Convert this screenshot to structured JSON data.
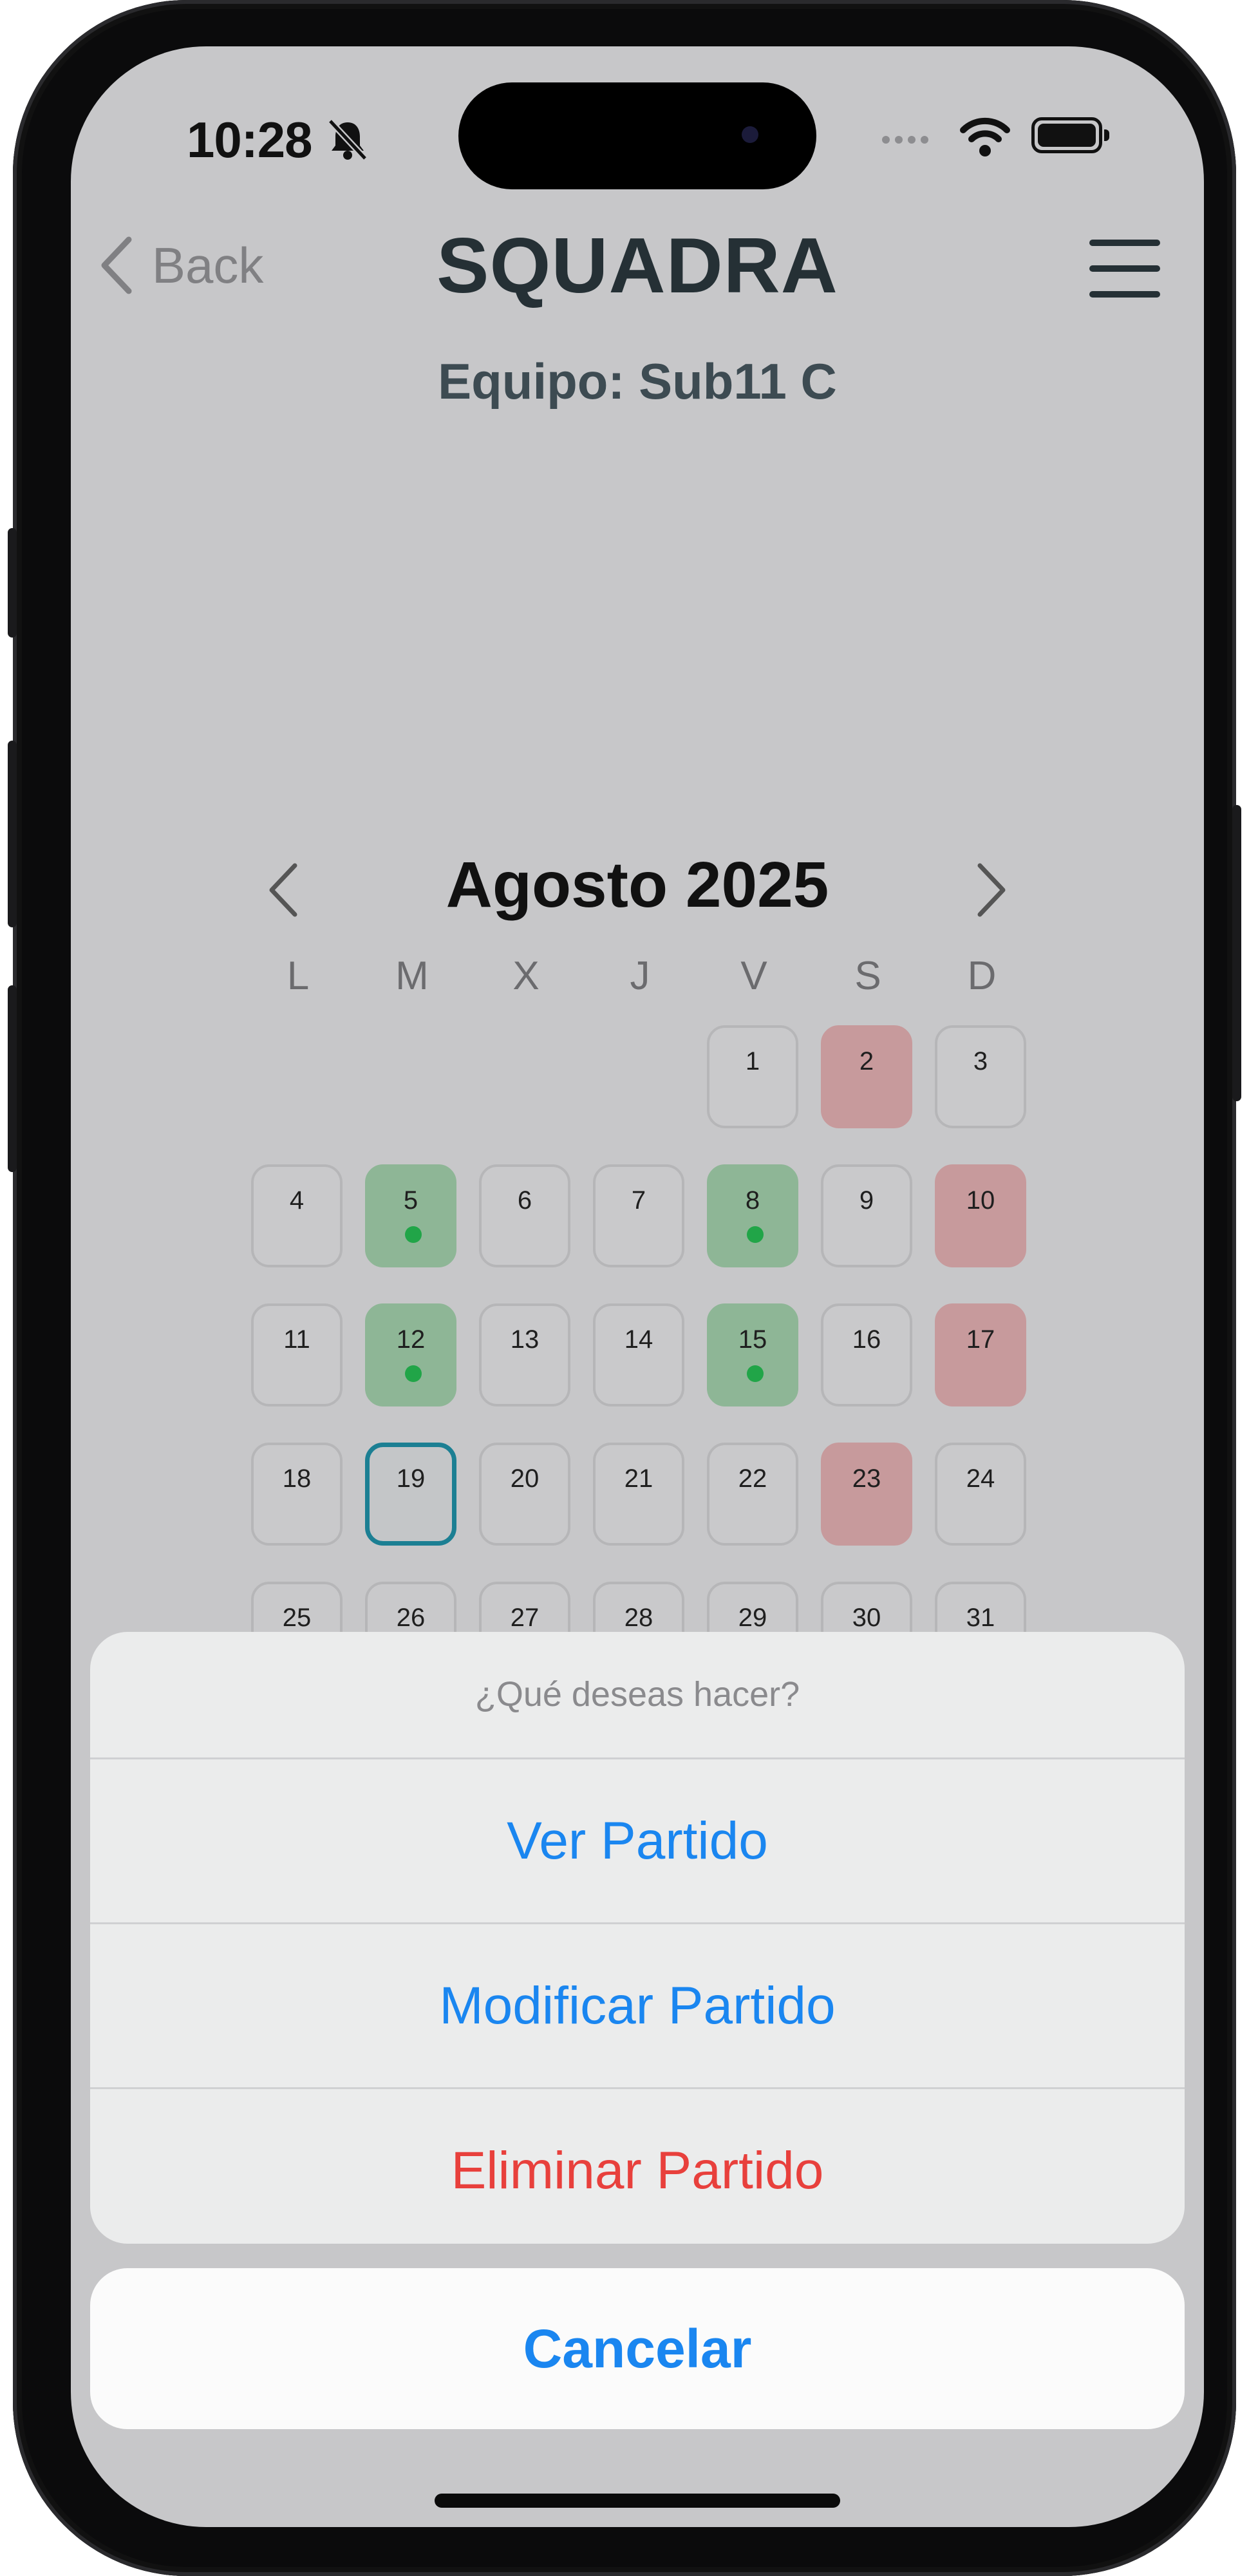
{
  "status_bar": {
    "time": "10:28"
  },
  "nav": {
    "back_label": "Back",
    "app_title": "SQUADRA"
  },
  "team_label": "Equipo: Sub11 C",
  "calendar": {
    "month_label": "Agosto 2025",
    "weekdays": [
      "L",
      "M",
      "X",
      "J",
      "V",
      "S",
      "D"
    ],
    "days": [
      {
        "num": "1",
        "col": 4,
        "row": 0,
        "status": "none",
        "dot": false
      },
      {
        "num": "2",
        "col": 5,
        "row": 0,
        "status": "red",
        "dot": false
      },
      {
        "num": "3",
        "col": 6,
        "row": 0,
        "status": "none",
        "dot": false
      },
      {
        "num": "4",
        "col": 0,
        "row": 1,
        "status": "none",
        "dot": false
      },
      {
        "num": "5",
        "col": 1,
        "row": 1,
        "status": "green",
        "dot": true
      },
      {
        "num": "6",
        "col": 2,
        "row": 1,
        "status": "none",
        "dot": false
      },
      {
        "num": "7",
        "col": 3,
        "row": 1,
        "status": "none",
        "dot": false
      },
      {
        "num": "8",
        "col": 4,
        "row": 1,
        "status": "green",
        "dot": true
      },
      {
        "num": "9",
        "col": 5,
        "row": 1,
        "status": "none",
        "dot": false
      },
      {
        "num": "10",
        "col": 6,
        "row": 1,
        "status": "red",
        "dot": false
      },
      {
        "num": "11",
        "col": 0,
        "row": 2,
        "status": "none",
        "dot": false
      },
      {
        "num": "12",
        "col": 1,
        "row": 2,
        "status": "green",
        "dot": true
      },
      {
        "num": "13",
        "col": 2,
        "row": 2,
        "status": "none",
        "dot": false
      },
      {
        "num": "14",
        "col": 3,
        "row": 2,
        "status": "none",
        "dot": false
      },
      {
        "num": "15",
        "col": 4,
        "row": 2,
        "status": "green",
        "dot": true
      },
      {
        "num": "16",
        "col": 5,
        "row": 2,
        "status": "none",
        "dot": false
      },
      {
        "num": "17",
        "col": 6,
        "row": 2,
        "status": "red",
        "dot": false
      },
      {
        "num": "18",
        "col": 0,
        "row": 3,
        "status": "none",
        "dot": false
      },
      {
        "num": "19",
        "col": 1,
        "row": 3,
        "status": "today",
        "dot": false
      },
      {
        "num": "20",
        "col": 2,
        "row": 3,
        "status": "none",
        "dot": false
      },
      {
        "num": "21",
        "col": 3,
        "row": 3,
        "status": "none",
        "dot": false
      },
      {
        "num": "22",
        "col": 4,
        "row": 3,
        "status": "none",
        "dot": false
      },
      {
        "num": "23",
        "col": 5,
        "row": 3,
        "status": "red",
        "dot": false
      },
      {
        "num": "24",
        "col": 6,
        "row": 3,
        "status": "none",
        "dot": false
      },
      {
        "num": "25",
        "col": 0,
        "row": 4,
        "status": "none",
        "dot": false
      },
      {
        "num": "26",
        "col": 1,
        "row": 4,
        "status": "none",
        "dot": false
      },
      {
        "num": "27",
        "col": 2,
        "row": 4,
        "status": "none",
        "dot": false
      },
      {
        "num": "28",
        "col": 3,
        "row": 4,
        "status": "none",
        "dot": false
      },
      {
        "num": "29",
        "col": 4,
        "row": 4,
        "status": "none",
        "dot": false
      },
      {
        "num": "30",
        "col": 5,
        "row": 4,
        "status": "none",
        "dot": false
      },
      {
        "num": "31",
        "col": 6,
        "row": 4,
        "status": "none",
        "dot": false
      }
    ]
  },
  "action_sheet": {
    "title": "¿Qué deseas hacer?",
    "view_label": "Ver Partido",
    "edit_label": "Modificar Partido",
    "delete_label": "Eliminar Partido",
    "cancel_label": "Cancelar"
  },
  "colors": {
    "accent": "#1a86f0",
    "destructive": "#e8403c",
    "match_day": "#8eb696",
    "unavailable_day": "#c79a9c",
    "today_border": "#1c7f93",
    "dim_background": "#c7c7c9"
  },
  "icons": {
    "status": [
      "bell-slash-icon",
      "cellular-signal-icon",
      "wifi-icon",
      "battery-icon"
    ],
    "nav": [
      "chevron-left-icon",
      "hamburger-menu-icon"
    ],
    "calendar": [
      "chevron-left-icon",
      "chevron-right-icon"
    ]
  }
}
